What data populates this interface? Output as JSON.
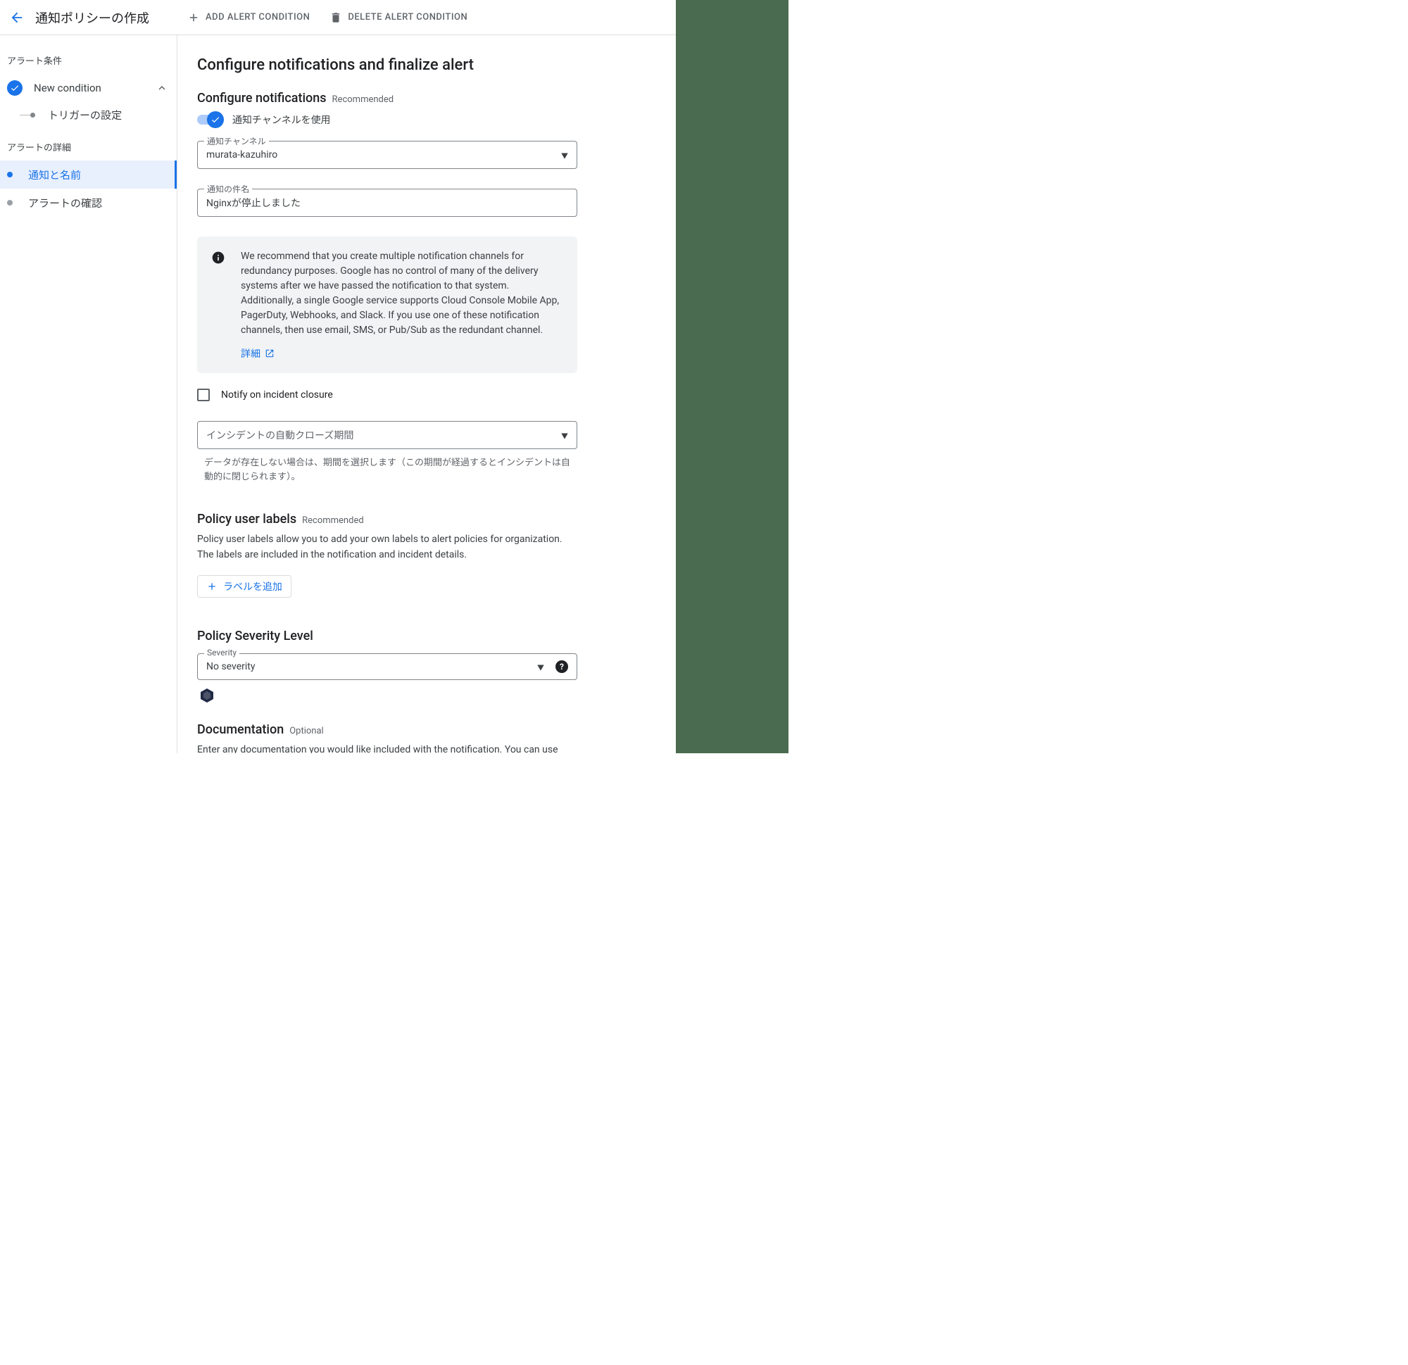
{
  "header": {
    "title": "通知ポリシーの作成",
    "add_condition": "ADD ALERT CONDITION",
    "delete_condition": "DELETE ALERT CONDITION"
  },
  "sidebar": {
    "sections": {
      "alert_conditions_label": "アラート条件",
      "alert_details_label": "アラートの詳細"
    },
    "new_condition_label": "New condition",
    "trigger_settings_label": "トリガーの設定",
    "notification_name_label": "通知と名前",
    "review_alert_label": "アラートの確認"
  },
  "main": {
    "title": "Configure notifications and finalize alert",
    "configure_notifications_title": "Configure notifications",
    "recommended_label": "Recommended",
    "optional_label": "Optional",
    "use_channels_toggle_label": "通知チャンネルを使用",
    "channel_field_label": "通知チャンネル",
    "channel_value": "murata-kazuhiro",
    "subject_field_label": "通知の件名",
    "subject_value": "Nginxが停止しました",
    "info_text": "We recommend that you create multiple notification channels for redundancy purposes. Google has no control of many of the delivery systems after we have passed the notification to that system. Additionally, a single Google service supports Cloud Console Mobile App, PagerDuty, Webhooks, and Slack. If you use one of these notification channels, then use email, SMS, or Pub/Sub as the redundant channel.",
    "learn_more": "詳細",
    "notify_closure_label": "Notify on incident closure",
    "autoclose_placeholder": "インシデントの自動クローズ期間",
    "autoclose_hint": "データが存在しない場合は、期間を選択します（この期間が経過するとインシデントは自動的に閉じられます）。",
    "policy_labels_title": "Policy user labels",
    "policy_labels_para": "Policy user labels allow you to add your own labels to alert policies for organization. The labels are included in the notification and incident details.",
    "add_label_btn": "ラベルを追加",
    "severity_title": "Policy Severity Level",
    "severity_field_label": "Severity",
    "severity_value": "No severity",
    "documentation_title": "Documentation",
    "documentation_para": "Enter any documentation you would like included with the notification. You can use"
  }
}
